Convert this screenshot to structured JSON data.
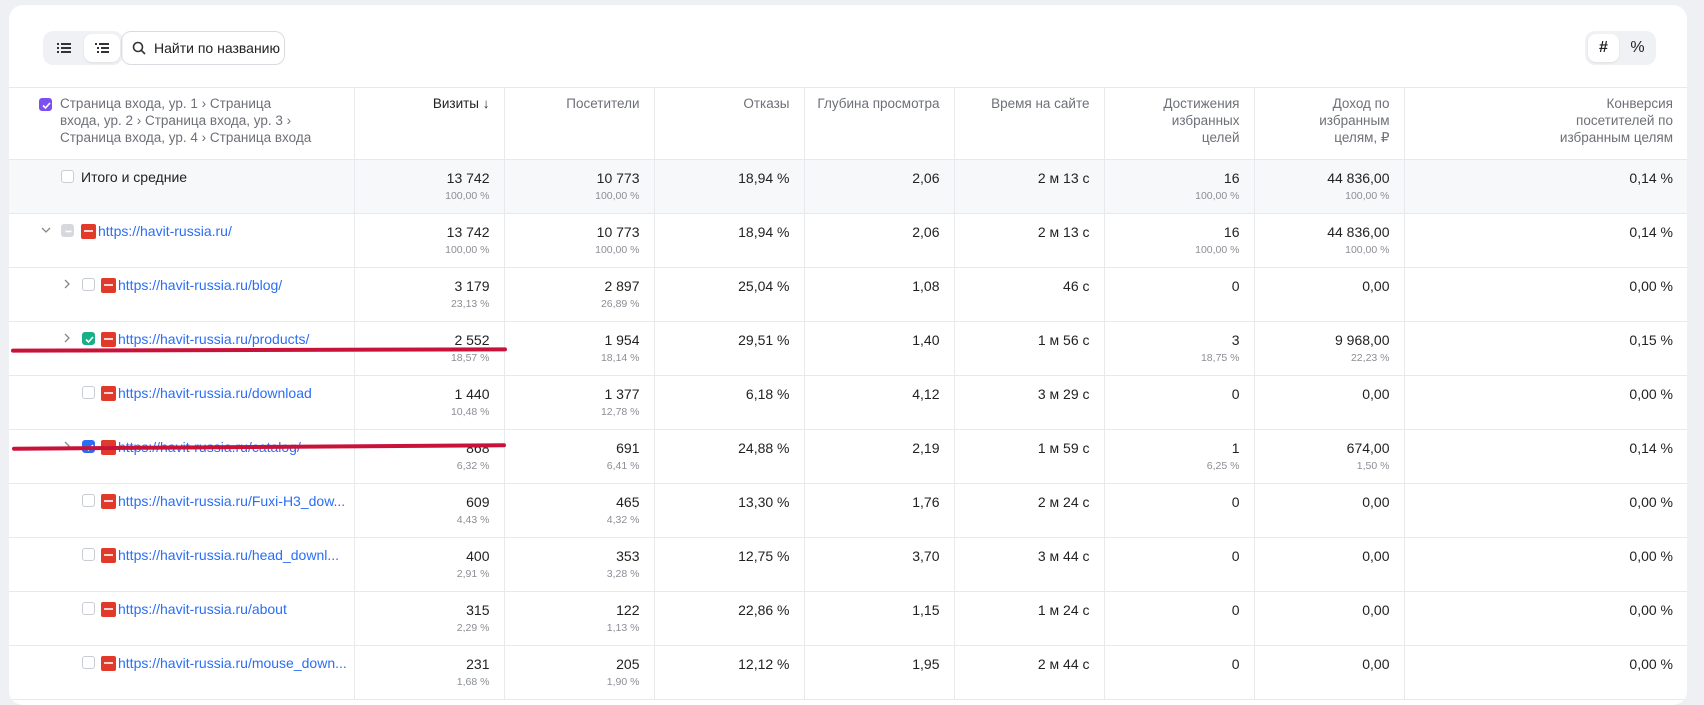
{
  "search": {
    "placeholder": "Найти по названию"
  },
  "mode": {
    "absolute": "#",
    "percent": "%"
  },
  "headers": {
    "dimension": "Страница входа, ур. 1 › Страница входа, ур. 2 › Страница входа, ур. 3 › Страница входа, ур. 4 › Страница входа",
    "visits": "Визиты ↓",
    "visitors": "Посетители",
    "bounces": "Отказы",
    "depth": "Глубина просмотра",
    "time": "Время на сайте",
    "goals": "Достижения избранных целей",
    "revenue": "Доход по избранным целям, ₽",
    "conversion": "Конверсия посетителей по избранным целям"
  },
  "total": {
    "label": "Итого и средние",
    "visits": "13 742",
    "visits_pct": "100,00 %",
    "visitors": "10 773",
    "visitors_pct": "100,00 %",
    "bounces": "18,94 %",
    "depth": "2,06",
    "time": "2 м 13 с",
    "goals": "16",
    "goals_pct": "100,00 %",
    "revenue": "44 836,00",
    "revenue_pct": "100,00 %",
    "conversion": "0,14 %"
  },
  "rows": [
    {
      "url": "https://havit-russia.ru/",
      "visits": "13 742",
      "visits_pct": "100,00 %",
      "visitors": "10 773",
      "visitors_pct": "100,00 %",
      "bounces": "18,94 %",
      "depth": "2,06",
      "time": "2 м 13 с",
      "goals": "16",
      "goals_pct": "100,00 %",
      "revenue": "44 836,00",
      "revenue_pct": "100,00 %",
      "conversion": "0,14 %"
    },
    {
      "url": "https://havit-russia.ru/blog/",
      "visits": "3 179",
      "visits_pct": "23,13 %",
      "visitors": "2 897",
      "visitors_pct": "26,89 %",
      "bounces": "25,04 %",
      "depth": "1,08",
      "time": "46 с",
      "goals": "0",
      "goals_pct": "",
      "revenue": "0,00",
      "revenue_pct": "",
      "conversion": "0,00 %"
    },
    {
      "url": "https://havit-russia.ru/products/",
      "visits": "2 552",
      "visits_pct": "18,57 %",
      "visitors": "1 954",
      "visitors_pct": "18,14 %",
      "bounces": "29,51 %",
      "depth": "1,40",
      "time": "1 м 56 с",
      "goals": "3",
      "goals_pct": "18,75 %",
      "revenue": "9 968,00",
      "revenue_pct": "22,23 %",
      "conversion": "0,15 %"
    },
    {
      "url": "https://havit-russia.ru/download",
      "visits": "1 440",
      "visits_pct": "10,48 %",
      "visitors": "1 377",
      "visitors_pct": "12,78 %",
      "bounces": "6,18 %",
      "depth": "4,12",
      "time": "3 м 29 с",
      "goals": "0",
      "goals_pct": "",
      "revenue": "0,00",
      "revenue_pct": "",
      "conversion": "0,00 %"
    },
    {
      "url": "https://havit-russia.ru/catalog/",
      "visits": "868",
      "visits_pct": "6,32 %",
      "visitors": "691",
      "visitors_pct": "6,41 %",
      "bounces": "24,88 %",
      "depth": "2,19",
      "time": "1 м 59 с",
      "goals": "1",
      "goals_pct": "6,25 %",
      "revenue": "674,00",
      "revenue_pct": "1,50 %",
      "conversion": "0,14 %"
    },
    {
      "url": "https://havit-russia.ru/Fuxi-H3_dow...",
      "visits": "609",
      "visits_pct": "4,43 %",
      "visitors": "465",
      "visitors_pct": "4,32 %",
      "bounces": "13,30 %",
      "depth": "1,76",
      "time": "2 м 24 с",
      "goals": "0",
      "goals_pct": "",
      "revenue": "0,00",
      "revenue_pct": "",
      "conversion": "0,00 %"
    },
    {
      "url": "https://havit-russia.ru/head_downl...",
      "visits": "400",
      "visits_pct": "2,91 %",
      "visitors": "353",
      "visitors_pct": "3,28 %",
      "bounces": "12,75 %",
      "depth": "3,70",
      "time": "3 м 44 с",
      "goals": "0",
      "goals_pct": "",
      "revenue": "0,00",
      "revenue_pct": "",
      "conversion": "0,00 %"
    },
    {
      "url": "https://havit-russia.ru/about",
      "visits": "315",
      "visits_pct": "2,29 %",
      "visitors": "122",
      "visitors_pct": "1,13 %",
      "bounces": "22,86 %",
      "depth": "1,15",
      "time": "1 м 24 с",
      "goals": "0",
      "goals_pct": "",
      "revenue": "0,00",
      "revenue_pct": "",
      "conversion": "0,00 %"
    },
    {
      "url": "https://havit-russia.ru/mouse_down...",
      "visits": "231",
      "visits_pct": "1,68 %",
      "visitors": "205",
      "visitors_pct": "1,90 %",
      "bounces": "12,12 %",
      "depth": "1,95",
      "time": "2 м 44 с",
      "goals": "0",
      "goals_pct": "",
      "revenue": "0,00",
      "revenue_pct": "",
      "conversion": "0,00 %"
    }
  ],
  "colors": {
    "link": "#2a6ef6",
    "checkbox_blue": "#2a6ef6",
    "checkbox_green": "#17b086",
    "checkbox_purple": "#7c4ff0",
    "annotation_line": "#c9123a"
  }
}
